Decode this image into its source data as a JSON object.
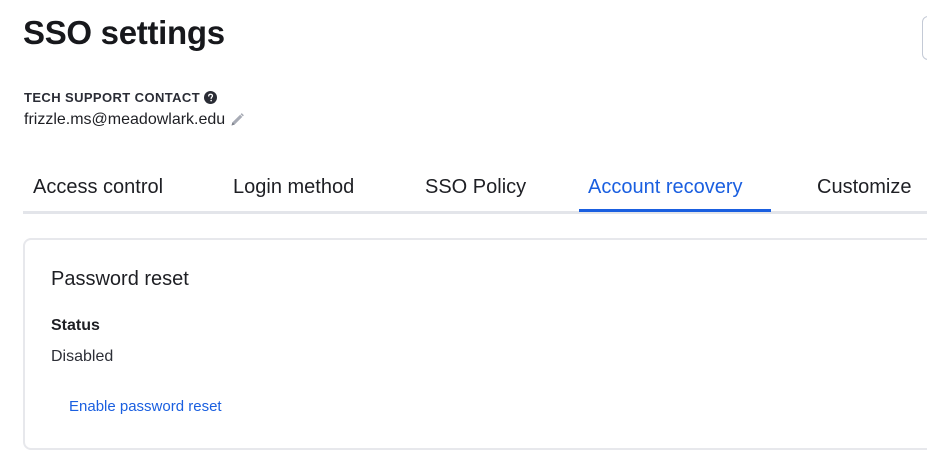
{
  "header": {
    "title": "SSO settings"
  },
  "contact": {
    "label": "TECH SUPPORT CONTACT",
    "help_icon": "question-circle-icon",
    "value": "frizzle.ms@meadowlark.edu",
    "edit_icon": "pencil-icon"
  },
  "tabs": [
    {
      "label": "Access control",
      "active": false
    },
    {
      "label": "Login method",
      "active": false
    },
    {
      "label": "SSO Policy",
      "active": false
    },
    {
      "label": "Account recovery",
      "active": true
    },
    {
      "label": "Customize",
      "active": false
    }
  ],
  "password_reset": {
    "title": "Password reset",
    "status_label": "Status",
    "status_value": "Disabled",
    "enable_link": "Enable password reset"
  },
  "colors": {
    "accent": "#1a5fe0",
    "text": "#1e1f24",
    "divider": "#e3e5ea",
    "card_border": "#e7e8ec"
  }
}
